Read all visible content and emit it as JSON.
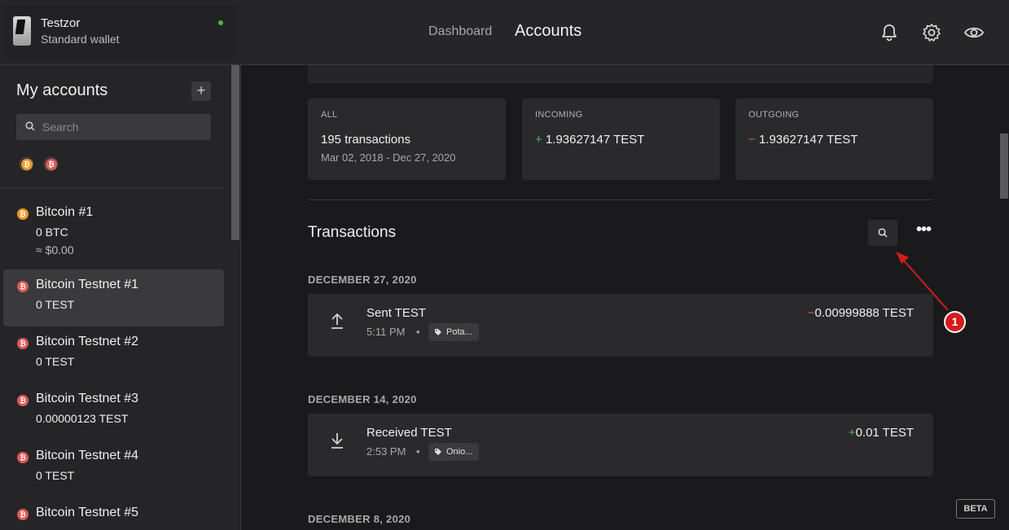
{
  "device": {
    "name": "Testzor",
    "type": "Standard wallet"
  },
  "nav": {
    "dashboard": "Dashboard",
    "accounts": "Accounts"
  },
  "sidebar": {
    "title": "My accounts",
    "add_label": "+",
    "search_placeholder": "Search",
    "coin_filters": [
      "btc",
      "test"
    ],
    "accounts": [
      {
        "name": "Bitcoin #1",
        "coin": "btc",
        "balance": "0 BTC",
        "fiat": "≈ $0.00",
        "selected": false
      },
      {
        "name": "Bitcoin Testnet #1",
        "coin": "test",
        "balance": "0 TEST",
        "selected": true
      },
      {
        "name": "Bitcoin Testnet #2",
        "coin": "test",
        "balance": "0 TEST",
        "selected": false
      },
      {
        "name": "Bitcoin Testnet #3",
        "coin": "test",
        "balance": "0.00000123 TEST",
        "selected": false
      },
      {
        "name": "Bitcoin Testnet #4",
        "coin": "test",
        "balance": "0 TEST",
        "selected": false
      },
      {
        "name": "Bitcoin Testnet #5",
        "coin": "test",
        "balance": "",
        "selected": false
      }
    ]
  },
  "summary": {
    "all": {
      "label": "ALL",
      "value": "195 transactions",
      "range": "Mar 02, 2018 - Dec 27, 2020"
    },
    "incoming": {
      "label": "INCOMING",
      "sign": "+",
      "value": "1.93627147 TEST"
    },
    "outgoing": {
      "label": "OUTGOING",
      "sign": "−",
      "value": "1.93627147 TEST"
    }
  },
  "transactions": {
    "title": "Transactions",
    "groups": [
      {
        "date": "DECEMBER 27, 2020",
        "items": [
          {
            "type": "Sent TEST",
            "time": "5:11 PM",
            "label": "Pota...",
            "sign": "−",
            "amount": "0.00999888 TEST",
            "direction": "out"
          }
        ]
      },
      {
        "date": "DECEMBER 14, 2020",
        "items": [
          {
            "type": "Received TEST",
            "time": "2:53 PM",
            "label": "Onio...",
            "sign": "+",
            "amount": "0.01 TEST",
            "direction": "in"
          }
        ]
      },
      {
        "date": "DECEMBER 8, 2020",
        "items": []
      }
    ]
  },
  "beta_badge": "BETA",
  "annotation": {
    "number": "1",
    "color": "#d41c1c"
  },
  "colors": {
    "accent_positive": "#4ab84a",
    "accent_negative": "#e0604a",
    "btc": "#f09a2a",
    "testnet": "#e05a5a"
  }
}
